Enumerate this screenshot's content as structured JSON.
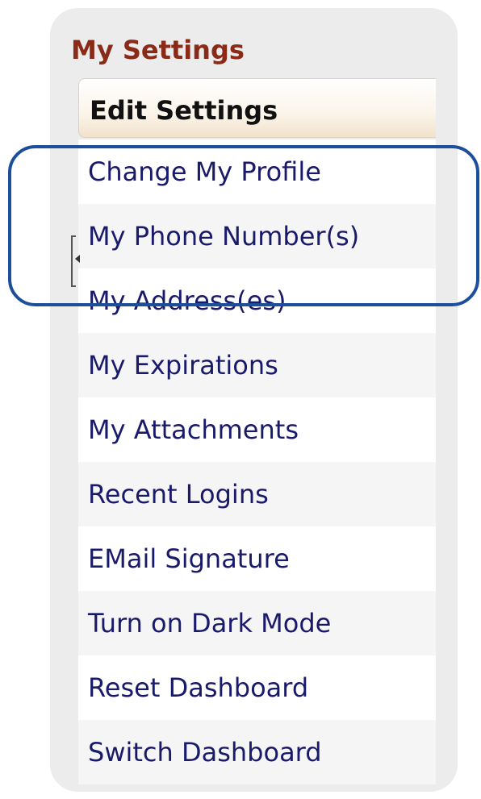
{
  "panel": {
    "title": "My Settings"
  },
  "menu": {
    "header": "Edit Settings",
    "items": [
      {
        "label": "Change My Profile"
      },
      {
        "label": "My Phone Number(s)"
      },
      {
        "label": "My Address(es)"
      },
      {
        "label": "My Expirations"
      },
      {
        "label": "My Attachments"
      },
      {
        "label": "Recent Logins"
      },
      {
        "label": "EMail Signature"
      },
      {
        "label": "Turn on Dark Mode"
      },
      {
        "label": "Reset Dashboard"
      },
      {
        "label": "Switch Dashboard"
      }
    ]
  },
  "colors": {
    "title": "#8b2a16",
    "link": "#1a1a6b",
    "highlight_border": "#1b4f9c",
    "panel_background": "#ececec"
  },
  "icons": {
    "cursor": "text-cursor-icon"
  }
}
